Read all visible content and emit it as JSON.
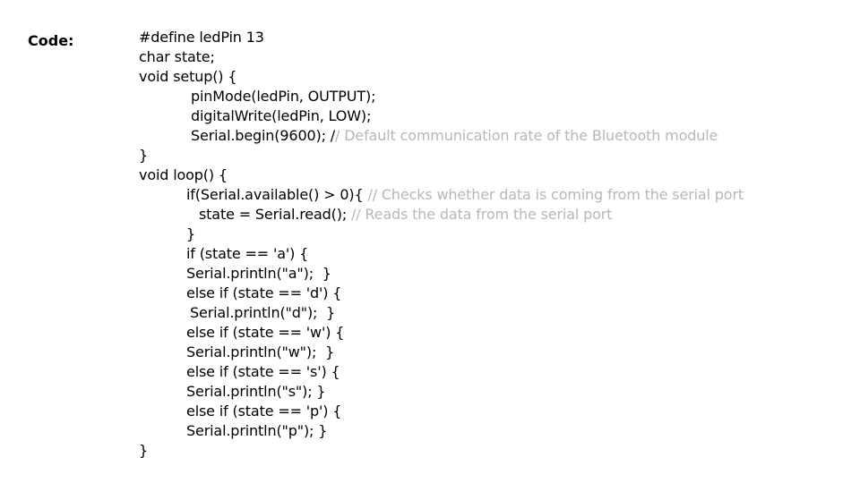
{
  "label": "Code:",
  "colors": {
    "text": "#000000",
    "comment": "#b7b7b7",
    "background": "#ffffff"
  },
  "code_lines": [
    {
      "indent": 0,
      "code": "#define ledPin 13",
      "comment": ""
    },
    {
      "indent": 0,
      "code": "char state;",
      "comment": ""
    },
    {
      "indent": 0,
      "code": "void setup() {",
      "comment": ""
    },
    {
      "indent": 58,
      "code": "pinMode(ledPin, OUTPUT);",
      "comment": ""
    },
    {
      "indent": 58,
      "code": "digitalWrite(ledPin, LOW);",
      "comment": ""
    },
    {
      "indent": 58,
      "code": "Serial.begin(9600); /",
      "comment": "/ Default communication rate of the Bluetooth module"
    },
    {
      "indent": 0,
      "code": "}",
      "comment": ""
    },
    {
      "indent": 0,
      "code": "void loop() {",
      "comment": ""
    },
    {
      "indent": 53,
      "code": "if(Serial.available() > 0){",
      "comment": " // Checks whether data is coming from the serial port"
    },
    {
      "indent": 67,
      "code": "state = Serial.read();",
      "comment": " // Reads the data from the serial port"
    },
    {
      "indent": 53,
      "code": "}",
      "comment": ""
    },
    {
      "indent": 53,
      "code": "if (state == 'a') {",
      "comment": ""
    },
    {
      "indent": 53,
      "code": "Serial.println(\"a\");  }",
      "comment": ""
    },
    {
      "indent": 53,
      "code": "else if (state == 'd') {",
      "comment": ""
    },
    {
      "indent": 57,
      "code": "Serial.println(\"d\");  }",
      "comment": ""
    },
    {
      "indent": 53,
      "code": "else if (state == 'w') {",
      "comment": ""
    },
    {
      "indent": 53,
      "code": "Serial.println(\"w\");  }",
      "comment": ""
    },
    {
      "indent": 53,
      "code": "else if (state == 's') {",
      "comment": ""
    },
    {
      "indent": 53,
      "code": "Serial.println(\"s\"); }",
      "comment": ""
    },
    {
      "indent": 53,
      "code": "else if (state == 'p') {",
      "comment": ""
    },
    {
      "indent": 53,
      "code": "Serial.println(\"p\"); }",
      "comment": ""
    },
    {
      "indent": 0,
      "code": "}",
      "comment": ""
    }
  ]
}
